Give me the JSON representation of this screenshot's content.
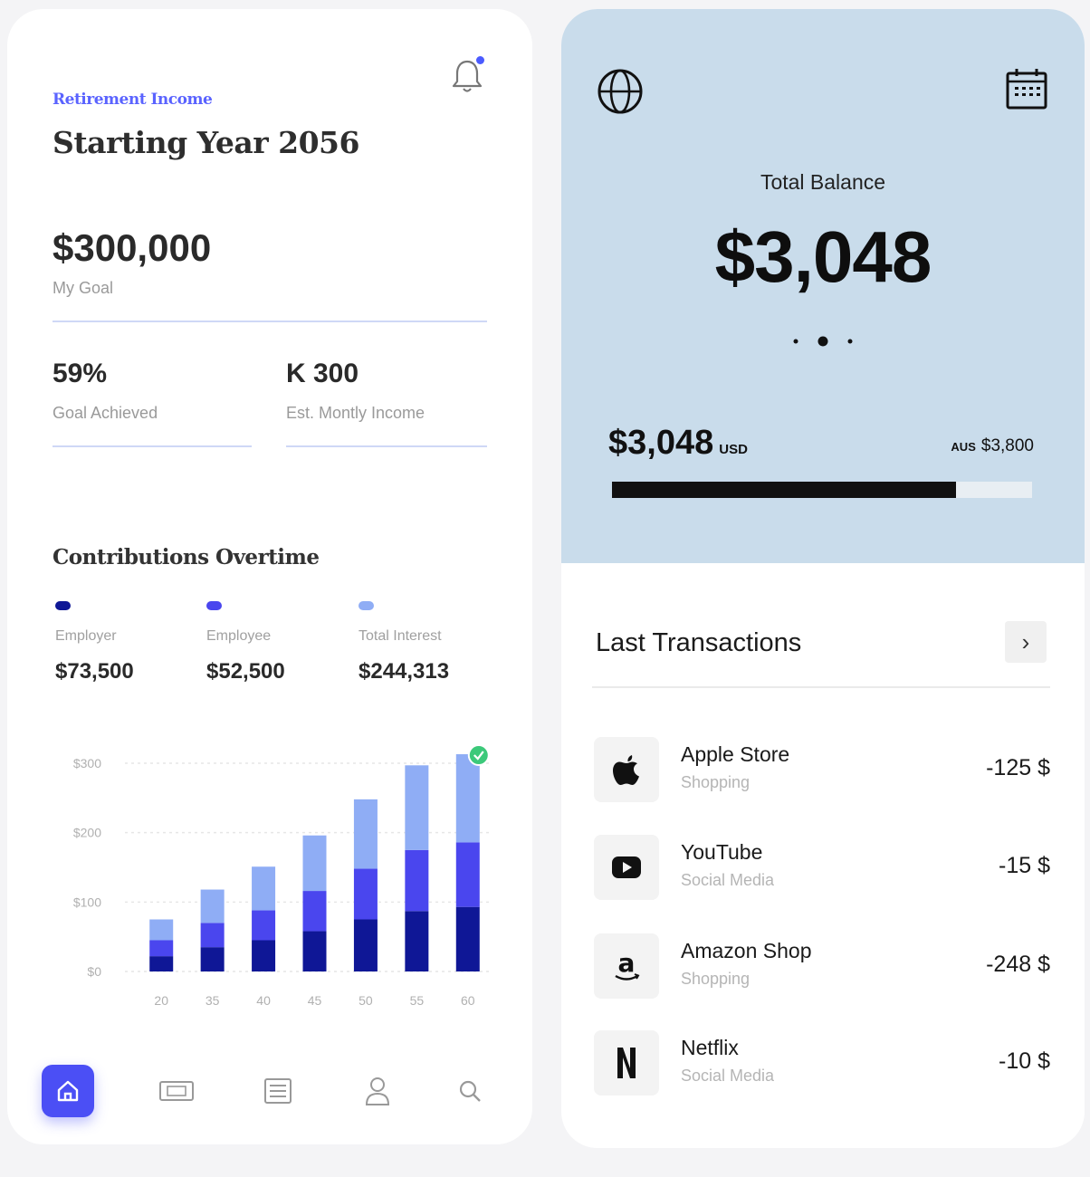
{
  "retirement": {
    "subtitle": "Retirement Income",
    "title": "Starting Year 2056",
    "goal_value": "$300,000",
    "goal_label": "My Goal",
    "stats": [
      {
        "value": "59%",
        "label": "Goal Achieved"
      },
      {
        "value": "K 300",
        "label": "Est. Montly Income"
      }
    ],
    "contributions_title": "Contributions Overtime",
    "legend": [
      {
        "label": "Employer",
        "value": "$73,500",
        "color": "#0f1796"
      },
      {
        "label": "Employee",
        "value": "$52,500",
        "color": "#4a46ee"
      },
      {
        "label": "Total Interest",
        "value": "$244,313",
        "color": "#8fadf5"
      }
    ]
  },
  "chart_data": {
    "type": "bar",
    "stacked": true,
    "categories": [
      "20",
      "35",
      "40",
      "45",
      "50",
      "55",
      "60"
    ],
    "y_tick_labels": [
      "$0",
      "$100",
      "$200",
      "$300"
    ],
    "ylim": [
      0,
      300
    ],
    "grid": true,
    "series": [
      {
        "name": "Employer",
        "values": [
          22,
          35,
          45,
          58,
          75,
          87,
          93
        ]
      },
      {
        "name": "Employee",
        "values": [
          23,
          35,
          43,
          58,
          73,
          88,
          93
        ]
      },
      {
        "name": "Total Interest",
        "values": [
          30,
          48,
          63,
          80,
          100,
          122,
          127
        ]
      }
    ],
    "marker": "check",
    "colors": [
      "#0f1796",
      "#4a46ee",
      "#8fadf5"
    ]
  },
  "nav": {
    "items": [
      {
        "icon": "home-icon",
        "active": true
      },
      {
        "icon": "wallet-icon",
        "active": false
      },
      {
        "icon": "list-icon",
        "active": false
      },
      {
        "icon": "user-icon",
        "active": false
      },
      {
        "icon": "search-icon",
        "active": false
      }
    ]
  },
  "balance": {
    "label": "Total Balance",
    "value": "$3,048",
    "usd_value": "$3,048",
    "usd_unit": "USD",
    "aud_unit": "AUS",
    "aud_value": "$3,800",
    "progress_fraction": 0.82,
    "carousel_active_index": 1,
    "carousel_count": 3,
    "panel_color": "#c9dceb"
  },
  "transactions": {
    "title": "Last Transactions",
    "items": [
      {
        "name": "Apple Store",
        "category": "Shopping",
        "amount": "-125 $",
        "icon": "apple-icon"
      },
      {
        "name": "YouTube",
        "category": "Social Media",
        "amount": "-15 $",
        "icon": "youtube-icon"
      },
      {
        "name": "Amazon Shop",
        "category": "Shopping",
        "amount": "-248 $",
        "icon": "amazon-icon"
      },
      {
        "name": "Netflix",
        "category": "Social Media",
        "amount": "-10 $",
        "icon": "netflix-icon"
      }
    ]
  }
}
